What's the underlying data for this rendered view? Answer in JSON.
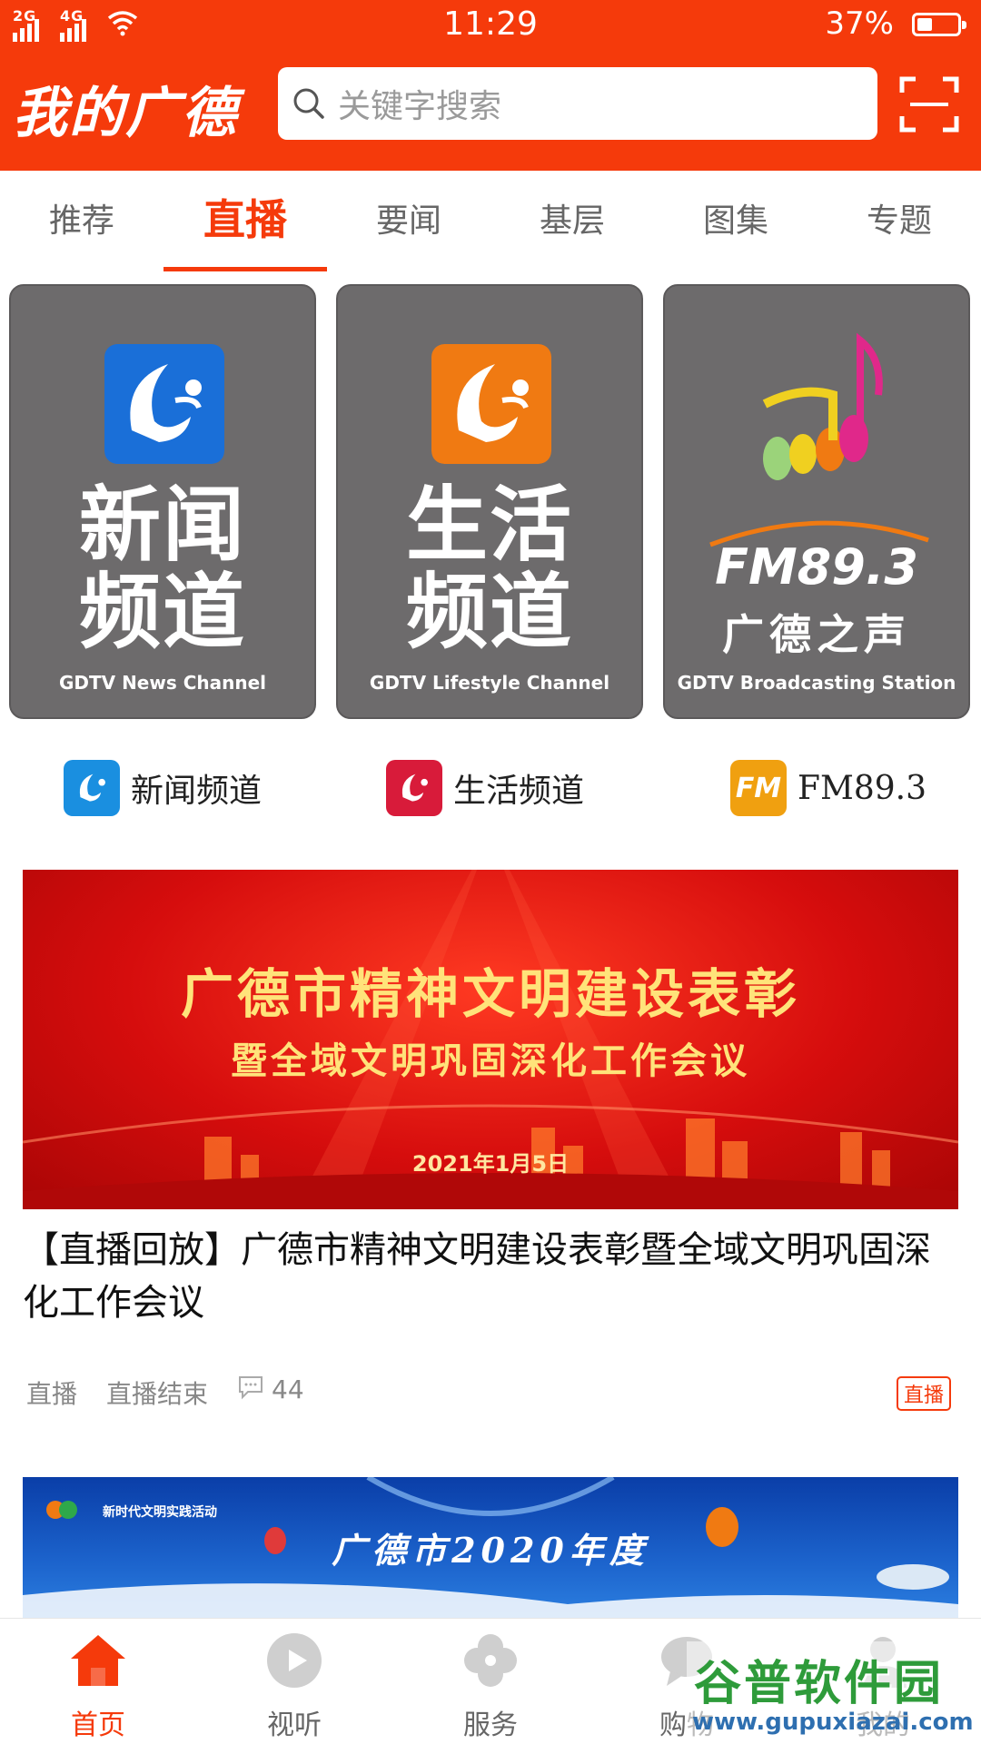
{
  "status_bar": {
    "signal1": "2G",
    "signal2": "4G",
    "time": "11:29",
    "battery_pct": "37%",
    "battery_level": 0.37
  },
  "header": {
    "app_title": "我的广德",
    "search_placeholder": "关键字搜索"
  },
  "tabs": [
    {
      "label": "推荐"
    },
    {
      "label": "直播"
    },
    {
      "label": "要闻"
    },
    {
      "label": "基层"
    },
    {
      "label": "图集"
    },
    {
      "label": "专题"
    }
  ],
  "active_tab": "直播",
  "channel_cards": [
    {
      "line1": "新闻",
      "line2": "频道",
      "en": "GDTV News Channel",
      "logo_color": "#1a6fd8"
    },
    {
      "line1": "生活",
      "line2": "频道",
      "en": "GDTV Lifestyle Channel",
      "logo_color": "#f07a12"
    },
    {
      "fm": "FM89.3",
      "name": "广德之声",
      "en": "GDTV Broadcasting Station"
    }
  ],
  "quick_links": [
    {
      "label": "新闻频道",
      "icon": "news-channel-icon",
      "color": "#1a8fe0"
    },
    {
      "label": "生活频道",
      "icon": "life-channel-icon",
      "color": "#d81b3a"
    },
    {
      "label": "FM89.3",
      "icon": "fm-icon",
      "icon_text": "FM",
      "color": "#f0a010"
    }
  ],
  "feed": [
    {
      "banner_title": "广德市精神文明建设表彰",
      "banner_subtitle": "暨全域文明巩固深化工作会议",
      "banner_date": "2021年1月5日",
      "title": "【直播回放】广德市精神文明建设表彰暨全域文明巩固深化工作会议",
      "category": "直播",
      "status": "直播结束",
      "comments": "44",
      "tag": "直播"
    },
    {
      "banner_top": "新时代文明实践活动",
      "banner_title": "广德市2020年度"
    }
  ],
  "bottom_nav": [
    {
      "label": "首页",
      "icon": "home-icon"
    },
    {
      "label": "视听",
      "icon": "play-icon"
    },
    {
      "label": "服务",
      "icon": "clover-icon"
    },
    {
      "label": "购物",
      "icon": "chat-icon"
    },
    {
      "label": "我的",
      "icon": "user-icon"
    }
  ],
  "watermark": {
    "name": "谷普软件园",
    "url": "www.gupuxiazai.com"
  },
  "colors": {
    "accent": "#f53a0b",
    "card_bg": "#6d6b6c"
  }
}
